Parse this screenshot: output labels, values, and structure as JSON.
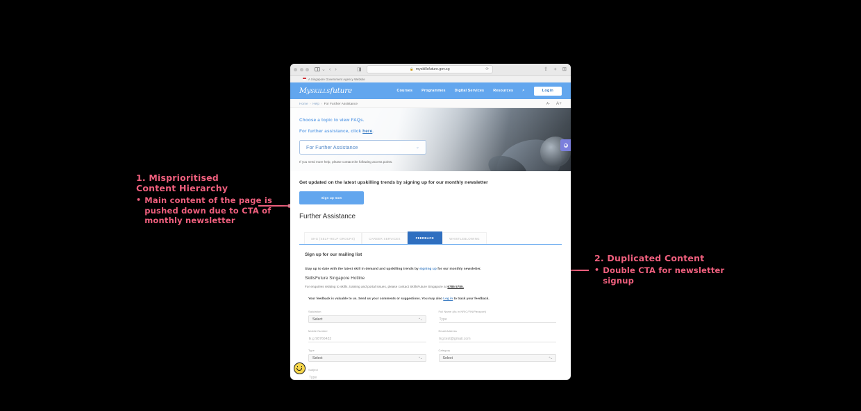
{
  "annotations": [
    {
      "number_title": "1. Misprioritised\nContent Hierarchy",
      "bullet_marker": "•",
      "bullet_text": "Main content of the page is pushed down due to CTA of monthly newsletter"
    },
    {
      "number_title": "2. Duplicated Content",
      "bullet_marker": "•",
      "bullet_text": "Double CTA for newsletter signup"
    }
  ],
  "browser": {
    "url": "myskillsfuture.gov.sg",
    "lock": "🔒",
    "reload": "⟳",
    "back": "‹",
    "forward": "›",
    "share": "⇧",
    "new_tab": "+",
    "tab_overview": "⊞",
    "reader": "◨"
  },
  "gov_banner": {
    "text": "A Singapore Government Agency Website"
  },
  "site_header": {
    "logo_my": "My",
    "logo_skills": "SKILLS",
    "logo_future": "future",
    "nav": [
      {
        "label": "Courses"
      },
      {
        "label": "Programmes"
      },
      {
        "label": "Digital Services"
      },
      {
        "label": "Resources"
      }
    ],
    "search_icon": "⌕",
    "login_label": "Login"
  },
  "breadcrumb": {
    "items": [
      "Home",
      "Help",
      "For Further Assistance"
    ],
    "separator": "›",
    "font_decrease": "A-",
    "font_increase": "A+"
  },
  "hero": {
    "line1": "Choose a topic to view FAQs.",
    "line2_prefix": "For further assistance, click ",
    "line2_link": "here",
    "line2_suffix": ".",
    "dropdown_value": "For Further Assistance",
    "dropdown_caret": "⌄",
    "note": "If you need more help, please contact the following access points."
  },
  "newsletter": {
    "heading": "Get updated on the latest upskilling trends by signing up for our monthly newsletter",
    "button_label": "Sign up now"
  },
  "section": {
    "title": "Further Assistance"
  },
  "tabs": [
    {
      "label": "SHG (SELF-HELP GROUPS)",
      "active": false
    },
    {
      "label": "CAREER SERVICES",
      "active": false
    },
    {
      "label": "FEEDBACK",
      "active": true
    },
    {
      "label": "WHISTLEBLOWING",
      "active": false
    }
  ],
  "tab_content": {
    "mailing_heading": "Sign up for our mailing list",
    "mailing_para_prefix": "Stay up to date with the latest skill in demand and upskilling trends by ",
    "mailing_para_link": "signing up",
    "mailing_para_suffix": " for our monthly newsletter.",
    "hotline_heading": "SkillsFuture Singapore Hotline",
    "hotline_prefix": "For enquiries relating to skills, training and portal issues, please contact SkillsFuture Singapore at ",
    "hotline_number": "6785 5785.",
    "feedback_note_prefix": "Your feedback is valuable to us. Send us your comments or suggestions. You may also ",
    "feedback_note_link": "Log in",
    "feedback_note_suffix": " to track your feedback."
  },
  "form": {
    "fields": [
      {
        "label": "Salutation",
        "value": "Select",
        "type": "select"
      },
      {
        "label": "Full Name (As in NRIC/FIN/Passport)",
        "value": "Type",
        "type": "input"
      },
      {
        "label": "Mobile Number",
        "value": "E.g 98766432",
        "type": "input"
      },
      {
        "label": "Email Address",
        "value": "Eg.test@gmail.com",
        "type": "input"
      },
      {
        "label": "Type",
        "value": "Select",
        "type": "select"
      },
      {
        "label": "Category",
        "value": "Select",
        "type": "select"
      },
      {
        "label": "Subject",
        "value": "Type",
        "type": "input"
      }
    ],
    "stepper_glyph": "⌃⌄"
  },
  "widgets": {
    "smiley_label": "feedback-smiley",
    "float_button_label": "accessibility-toggle"
  },
  "colors": {
    "annotation_pink": "#ef5f7d",
    "brand_blue": "#62a6ee",
    "tab_active_blue": "#2f6fc0",
    "link_blue": "#3f7fc4",
    "float_purple": "#7b7fdc",
    "smiley_yellow": "#f7d74c"
  }
}
